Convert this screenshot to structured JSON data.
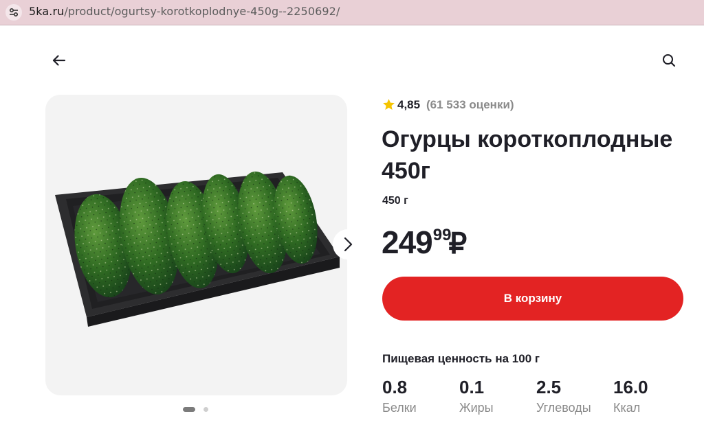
{
  "browser": {
    "url_domain": "5ka.ru",
    "url_path": "/product/ogurtsy-korotkoplodnye-450g--2250692/",
    "site_icon": "site-settings-icon"
  },
  "header": {
    "back_icon": "arrow-left-icon",
    "search_icon": "search-icon"
  },
  "gallery": {
    "image": "cucumbers-in-tray-photo",
    "next_icon": "chevron-right-icon",
    "pages": 2,
    "active_page": 1
  },
  "product": {
    "rating": "4,85",
    "rating_count": "(61 533 оценки)",
    "title": "Огурцы короткоплодные 450г",
    "weight": "450 г",
    "price_main": "249",
    "price_cents": "99",
    "currency": "₽"
  },
  "actions": {
    "add_to_cart": "В корзину"
  },
  "nutrition": {
    "title": "Пищевая ценность на 100 г",
    "items": [
      {
        "value": "0.8",
        "label": "Белки"
      },
      {
        "value": "0.1",
        "label": "Жиры"
      },
      {
        "value": "2.5",
        "label": "Углеводы"
      },
      {
        "value": "16.0",
        "label": "Ккал"
      }
    ]
  },
  "colors": {
    "accent": "#e32323",
    "star": "#f5c400",
    "urlbar": "#e9d0d6",
    "text_primary": "#1f1f27",
    "text_secondary": "#8a8a8a"
  }
}
